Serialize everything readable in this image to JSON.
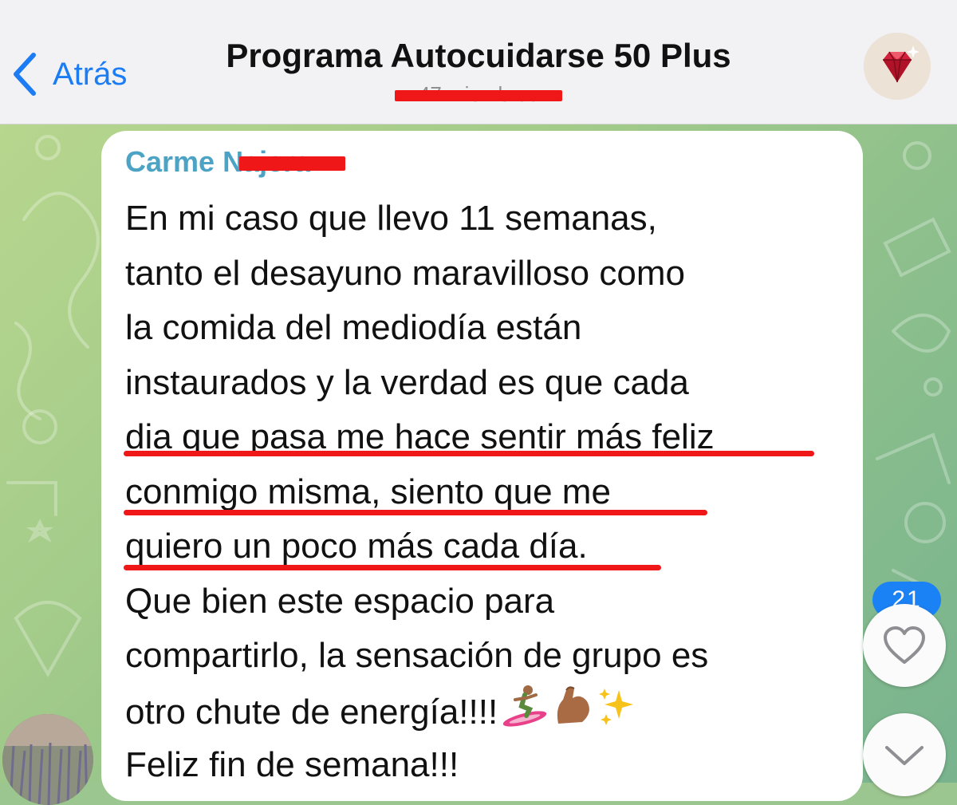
{
  "header": {
    "back_label": "Atrás",
    "title": "Programa Autocuidarse 50 Plus",
    "subtitle": "47 miembros"
  },
  "message": {
    "sender": "Carme Najera",
    "lines": [
      "En mi caso que llevo 11 semanas,",
      "tanto el desayuno maravilloso como",
      "la comida del mediodía están",
      "instaurados y la verdad es que cada",
      "dia que pasa me hace sentir más feliz",
      "conmigo misma, siento que me",
      "quiero un poco más cada día.",
      "Que bien este espacio para",
      "compartirlo, la sensación de grupo es",
      "otro chute de energía!!!!",
      "Feliz fin de semana!!!"
    ],
    "emojis": [
      "surfer-emoji",
      "flexed-biceps-emoji",
      "sparkles-emoji"
    ]
  },
  "reactions": {
    "count": "21",
    "icon": "heart-icon"
  },
  "colors": {
    "accent": "#1b7cf3",
    "sender_name": "#4da3c4",
    "redaction": "#ef1717",
    "badge": "#1b82f6"
  }
}
